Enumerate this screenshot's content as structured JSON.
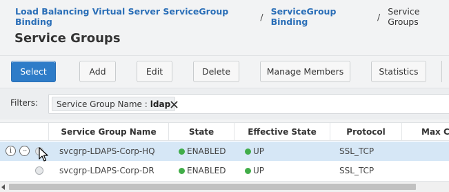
{
  "breadcrumb": {
    "items": [
      {
        "label": "Load Balancing Virtual Server ServiceGroup Binding"
      },
      {
        "label": "ServiceGroup Binding"
      },
      {
        "label": "Service Groups"
      }
    ],
    "separator": "/"
  },
  "page": {
    "title": "Service Groups"
  },
  "toolbar": {
    "select_label": "Select",
    "add_label": "Add",
    "edit_label": "Edit",
    "delete_label": "Delete",
    "manage_members_label": "Manage Members",
    "statistics_label": "Statistics"
  },
  "filters": {
    "label": "Filters:",
    "chip": {
      "name": "Service Group Name :",
      "value": "ldap"
    }
  },
  "table": {
    "columns": [
      "Service Group Name",
      "State",
      "Effective State",
      "Protocol",
      "Max Cli"
    ],
    "rows": [
      {
        "name": "svcgrp-LDAPS-Corp-HQ",
        "state": "ENABLED",
        "effective_state": "UP",
        "protocol": "SSL_TCP",
        "selected": true
      },
      {
        "name": "svcgrp-LDAPS-Corp-DR",
        "state": "ENABLED",
        "effective_state": "UP",
        "protocol": "SSL_TCP",
        "selected": false
      }
    ]
  },
  "icons": {
    "info": "info-icon",
    "more": "more-options-icon",
    "close": "close-icon",
    "cursor": "mouse-pointer-icon"
  },
  "colors": {
    "link": "#2a6eb7",
    "primary_button": "#2e7cc8",
    "status_up": "#41ad49",
    "selected_row": "#d6e7f6"
  }
}
